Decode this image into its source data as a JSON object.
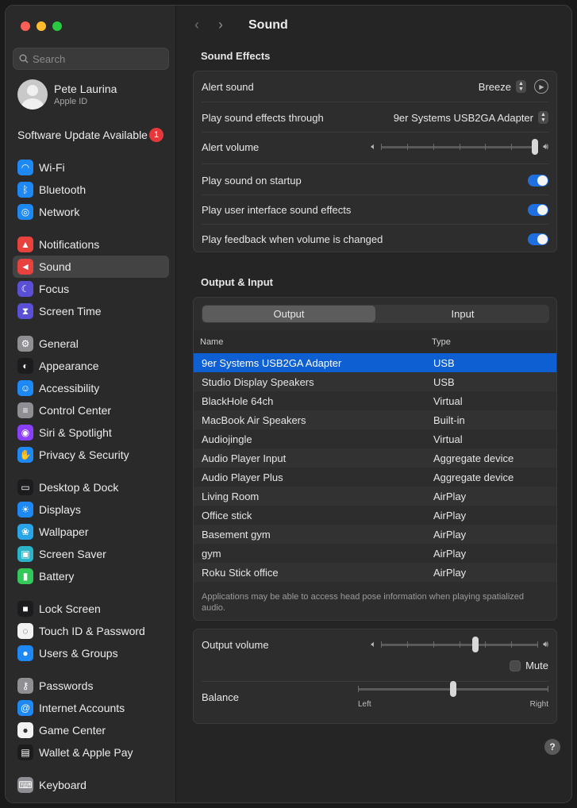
{
  "window": {
    "title": "Sound"
  },
  "sidebar": {
    "search_placeholder": "Search",
    "profile": {
      "name": "Pete Laurina",
      "subtitle": "Apple ID"
    },
    "update": {
      "label": "Software Update Available",
      "count": "1"
    },
    "groups": [
      [
        {
          "label": "Wi-Fi",
          "icon": "wifi-icon",
          "color": "#1e88f5"
        },
        {
          "label": "Bluetooth",
          "icon": "bluetooth-icon",
          "color": "#1e88f5"
        },
        {
          "label": "Network",
          "icon": "globe-icon",
          "color": "#1e88f5"
        }
      ],
      [
        {
          "label": "Notifications",
          "icon": "bell-icon",
          "color": "#e8423f"
        },
        {
          "label": "Sound",
          "icon": "speaker-icon",
          "color": "#e8423f",
          "selected": true
        },
        {
          "label": "Focus",
          "icon": "moon-icon",
          "color": "#5b4fd6"
        },
        {
          "label": "Screen Time",
          "icon": "hourglass-icon",
          "color": "#5b4fd6"
        }
      ],
      [
        {
          "label": "General",
          "icon": "gear-icon",
          "color": "#8e8e93"
        },
        {
          "label": "Appearance",
          "icon": "appearance-icon",
          "color": "#1c1c1e"
        },
        {
          "label": "Accessibility",
          "icon": "accessibility-icon",
          "color": "#1e88f5"
        },
        {
          "label": "Control Center",
          "icon": "switches-icon",
          "color": "#8e8e93"
        },
        {
          "label": "Siri & Spotlight",
          "icon": "siri-icon",
          "color": "#8a3ffc"
        },
        {
          "label": "Privacy & Security",
          "icon": "hand-icon",
          "color": "#1e88f5"
        }
      ],
      [
        {
          "label": "Desktop & Dock",
          "icon": "dock-icon",
          "color": "#1c1c1e"
        },
        {
          "label": "Displays",
          "icon": "sun-icon",
          "color": "#1e88f5"
        },
        {
          "label": "Wallpaper",
          "icon": "flower-icon",
          "color": "#2aa5e8"
        },
        {
          "label": "Screen Saver",
          "icon": "screensaver-icon",
          "color": "#2ab3c9"
        },
        {
          "label": "Battery",
          "icon": "battery-icon",
          "color": "#34c759"
        }
      ],
      [
        {
          "label": "Lock Screen",
          "icon": "lock-icon",
          "color": "#1c1c1e"
        },
        {
          "label": "Touch ID & Password",
          "icon": "fingerprint-icon",
          "color": "#f2f2f2"
        },
        {
          "label": "Users & Groups",
          "icon": "users-icon",
          "color": "#1e88f5"
        }
      ],
      [
        {
          "label": "Passwords",
          "icon": "key-icon",
          "color": "#8e8e93"
        },
        {
          "label": "Internet Accounts",
          "icon": "at-icon",
          "color": "#1e88f5"
        },
        {
          "label": "Game Center",
          "icon": "gamecenter-icon",
          "color": "#f2f2f2"
        },
        {
          "label": "Wallet & Apple Pay",
          "icon": "wallet-icon",
          "color": "#1c1c1e"
        }
      ],
      [
        {
          "label": "Keyboard",
          "icon": "keyboard-icon",
          "color": "#8e8e93"
        }
      ]
    ]
  },
  "sound_effects": {
    "title": "Sound Effects",
    "alert_sound_label": "Alert sound",
    "alert_sound_value": "Breeze",
    "play_through_label": "Play sound effects through",
    "play_through_value": "9er Systems USB2GA Adapter",
    "alert_volume_label": "Alert volume",
    "alert_volume_level": 0.98,
    "startup_label": "Play sound on startup",
    "startup_on": true,
    "ui_sounds_label": "Play user interface sound effects",
    "ui_sounds_on": true,
    "feedback_label": "Play feedback when volume is changed",
    "feedback_on": true
  },
  "output_input": {
    "title": "Output & Input",
    "tabs": [
      "Output",
      "Input"
    ],
    "active_tab": "Output",
    "columns": [
      "Name",
      "Type"
    ],
    "devices": [
      {
        "name": "9er Systems USB2GA Adapter",
        "type": "USB",
        "selected": true
      },
      {
        "name": "Studio Display Speakers",
        "type": "USB"
      },
      {
        "name": "BlackHole 64ch",
        "type": "Virtual"
      },
      {
        "name": "MacBook Air Speakers",
        "type": "Built-in"
      },
      {
        "name": "Audiojingle",
        "type": "Virtual"
      },
      {
        "name": "Audio Player Input",
        "type": "Aggregate device"
      },
      {
        "name": "Audio Player Plus",
        "type": "Aggregate device"
      },
      {
        "name": "Living Room",
        "type": "AirPlay"
      },
      {
        "name": "Office stick",
        "type": "AirPlay"
      },
      {
        "name": "Basement gym",
        "type": "AirPlay"
      },
      {
        "name": "gym",
        "type": "AirPlay"
      },
      {
        "name": "Roku Stick  office",
        "type": "AirPlay"
      }
    ],
    "note": "Applications may be able to access head pose information when playing spatialized audio."
  },
  "output_controls": {
    "volume_label": "Output volume",
    "volume_level": 0.6,
    "mute_label": "Mute",
    "muted": false,
    "balance_label": "Balance",
    "balance_level": 0.5,
    "balance_left": "Left",
    "balance_right": "Right"
  },
  "help_label": "?"
}
